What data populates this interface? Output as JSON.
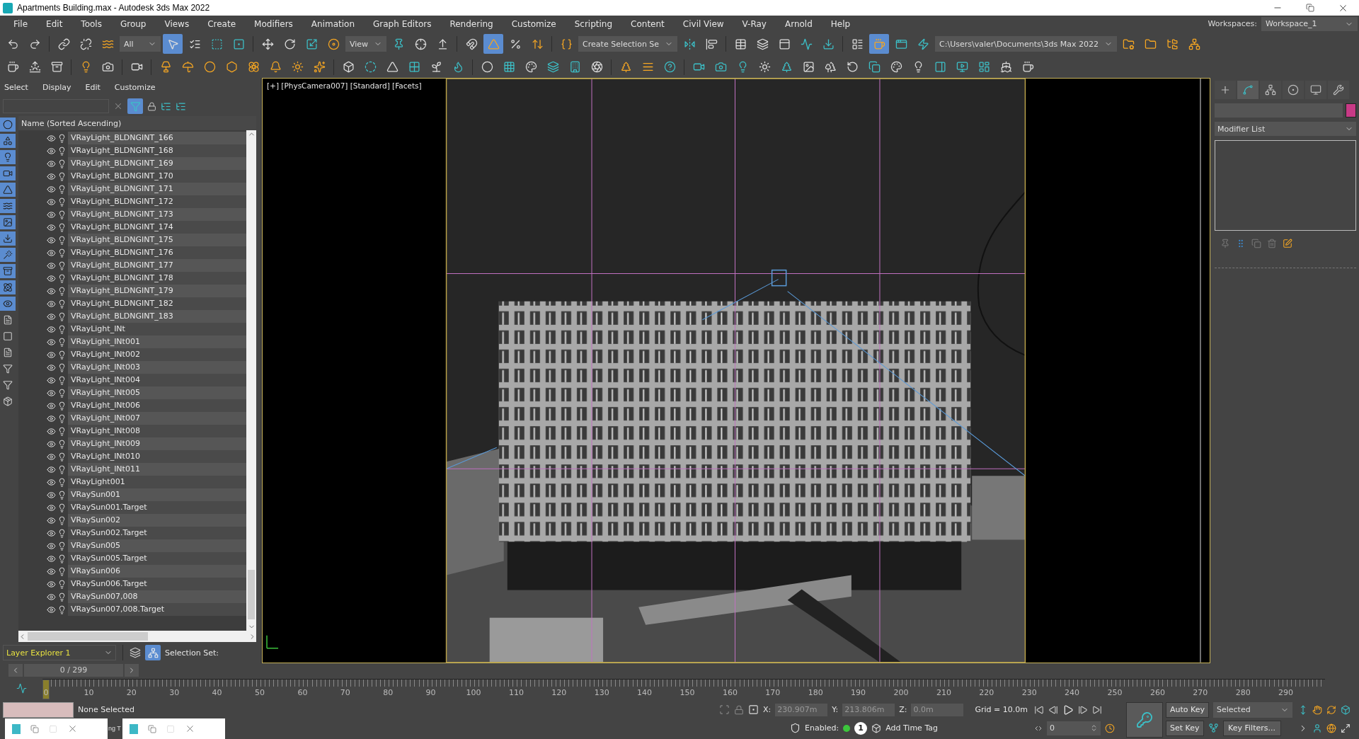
{
  "window": {
    "title": "Apartments Building.max - Autodesk 3ds Max 2022"
  },
  "menu": [
    "File",
    "Edit",
    "Tools",
    "Group",
    "Views",
    "Create",
    "Modifiers",
    "Animation",
    "Graph Editors",
    "Rendering",
    "Customize",
    "Scripting",
    "Content",
    "Civil View",
    "V-Ray",
    "Arnold",
    "Help"
  ],
  "workspaces": {
    "label": "Workspaces:",
    "value": "Workspace_1"
  },
  "toolbar_main": [
    {
      "kind": "tool",
      "selected": false
    },
    {
      "kind": "tool",
      "selected": false
    },
    {
      "kind": "separator"
    },
    {
      "kind": "tool",
      "selected": false
    },
    {
      "kind": "tool",
      "selected": false
    },
    {
      "kind": "tool",
      "selected": false
    },
    {
      "kind": "dropdown",
      "value": "All"
    },
    {
      "kind": "tool",
      "selected": true
    },
    {
      "kind": "tool",
      "selected": false
    },
    {
      "kind": "tool",
      "selected": false
    },
    {
      "kind": "tool",
      "selected": false
    },
    {
      "kind": "separator"
    },
    {
      "kind": "tool",
      "selected": false
    },
    {
      "kind": "tool",
      "selected": false
    },
    {
      "kind": "tool",
      "selected": false
    },
    {
      "kind": "tool",
      "selected": false
    },
    {
      "kind": "dropdown",
      "value": "View"
    },
    {
      "kind": "tool",
      "selected": false
    },
    {
      "kind": "tool",
      "selected": false
    },
    {
      "kind": "tool",
      "selected": false
    },
    {
      "kind": "separator"
    },
    {
      "kind": "tool",
      "selected": false
    },
    {
      "kind": "tool",
      "selected": true
    },
    {
      "kind": "tool",
      "selected": false
    },
    {
      "kind": "tool",
      "selected": false
    },
    {
      "kind": "separator"
    },
    {
      "kind": "tool",
      "selected": false
    },
    {
      "kind": "dropdown",
      "value": "Create Selection Se"
    },
    {
      "kind": "tool",
      "selected": false
    },
    {
      "kind": "tool",
      "selected": false
    },
    {
      "kind": "separator"
    },
    {
      "kind": "tool",
      "selected": false
    },
    {
      "kind": "tool",
      "selected": false
    },
    {
      "kind": "tool",
      "selected": false
    },
    {
      "kind": "tool",
      "selected": false
    },
    {
      "kind": "tool",
      "selected": false
    },
    {
      "kind": "separator"
    },
    {
      "kind": "tool",
      "selected": false
    },
    {
      "kind": "tool",
      "selected": true
    },
    {
      "kind": "tool",
      "selected": false
    },
    {
      "kind": "tool",
      "selected": false
    },
    {
      "kind": "dropdown",
      "value": "C:\\Users\\valer\\Documents\\3ds Max 2022"
    },
    {
      "kind": "tool",
      "selected": false
    },
    {
      "kind": "tool",
      "selected": false
    },
    {
      "kind": "tool",
      "selected": false
    },
    {
      "kind": "tool",
      "selected": false
    }
  ],
  "toolbar_secondary": [
    {
      "kind": "tool",
      "selected": false
    },
    {
      "kind": "tool",
      "selected": false
    },
    {
      "kind": "tool",
      "selected": false
    },
    {
      "kind": "separator"
    },
    {
      "kind": "tool",
      "selected": false
    },
    {
      "kind": "tool",
      "selected": false
    },
    {
      "kind": "separator"
    },
    {
      "kind": "tool",
      "selected": false
    },
    {
      "kind": "separator"
    },
    {
      "kind": "tool",
      "selected": false
    },
    {
      "kind": "tool",
      "selected": false
    },
    {
      "kind": "tool",
      "selected": false
    },
    {
      "kind": "tool",
      "selected": false
    },
    {
      "kind": "tool",
      "selected": false
    },
    {
      "kind": "tool",
      "selected": false
    },
    {
      "kind": "tool",
      "selected": false
    },
    {
      "kind": "tool",
      "selected": false
    },
    {
      "kind": "separator"
    },
    {
      "kind": "tool",
      "selected": false
    },
    {
      "kind": "tool",
      "selected": false
    },
    {
      "kind": "tool",
      "selected": false
    },
    {
      "kind": "tool",
      "selected": false
    },
    {
      "kind": "tool",
      "selected": false
    },
    {
      "kind": "tool",
      "selected": false
    },
    {
      "kind": "separator"
    },
    {
      "kind": "tool",
      "selected": false
    },
    {
      "kind": "tool",
      "selected": false
    },
    {
      "kind": "tool",
      "selected": false
    },
    {
      "kind": "tool",
      "selected": false
    },
    {
      "kind": "tool",
      "selected": false
    },
    {
      "kind": "tool",
      "selected": false
    },
    {
      "kind": "separator"
    },
    {
      "kind": "tool",
      "selected": false
    },
    {
      "kind": "tool",
      "selected": false
    },
    {
      "kind": "tool",
      "selected": false
    },
    {
      "kind": "separator"
    },
    {
      "kind": "tool",
      "selected": false
    },
    {
      "kind": "tool",
      "selected": false
    },
    {
      "kind": "tool",
      "selected": false
    },
    {
      "kind": "tool",
      "selected": false
    },
    {
      "kind": "tool",
      "selected": false
    },
    {
      "kind": "tool",
      "selected": false
    },
    {
      "kind": "tool",
      "selected": false
    },
    {
      "kind": "tool",
      "selected": false
    },
    {
      "kind": "tool",
      "selected": false
    },
    {
      "kind": "tool",
      "selected": false
    },
    {
      "kind": "tool",
      "selected": false
    },
    {
      "kind": "tool",
      "selected": false
    },
    {
      "kind": "tool",
      "selected": false
    },
    {
      "kind": "tool",
      "selected": false
    },
    {
      "kind": "tool",
      "selected": false
    },
    {
      "kind": "tool",
      "selected": false
    }
  ],
  "scene_explorer": {
    "menu": [
      "Select",
      "Display",
      "Edit",
      "Customize"
    ],
    "header": "Name (Sorted Ascending)",
    "filters": [
      {
        "selected": true
      },
      {
        "selected": true
      },
      {
        "selected": true
      },
      {
        "selected": true
      },
      {
        "selected": true
      },
      {
        "selected": true
      },
      {
        "selected": true
      },
      {
        "selected": true
      },
      {
        "selected": true
      },
      {
        "selected": true
      },
      {
        "selected": true
      },
      {
        "selected": true
      },
      {
        "selected": false
      },
      {
        "selected": false
      },
      {
        "selected": false
      },
      {
        "selected": false
      },
      {
        "selected": false
      },
      {
        "selected": false
      }
    ],
    "items": [
      {
        "name": "VRayLight_BLDNGINT_166"
      },
      {
        "name": "VRayLight_BLDNGINT_168"
      },
      {
        "name": "VRayLight_BLDNGINT_169"
      },
      {
        "name": "VRayLight_BLDNGINT_170"
      },
      {
        "name": "VRayLight_BLDNGINT_171"
      },
      {
        "name": "VRayLight_BLDNGINT_172"
      },
      {
        "name": "VRayLight_BLDNGINT_173"
      },
      {
        "name": "VRayLight_BLDNGINT_174"
      },
      {
        "name": "VRayLight_BLDNGINT_175"
      },
      {
        "name": "VRayLight_BLDNGINT_176"
      },
      {
        "name": "VRayLight_BLDNGINT_177"
      },
      {
        "name": "VRayLight_BLDNGINT_178"
      },
      {
        "name": "VRayLight_BLDNGINT_179"
      },
      {
        "name": "VRayLight_BLDNGINT_182"
      },
      {
        "name": "VRayLight_BLDNGINT_183"
      },
      {
        "name": "VRayLight_INt"
      },
      {
        "name": "VRayLight_INt001"
      },
      {
        "name": "VRayLight_INt002"
      },
      {
        "name": "VRayLight_INt003"
      },
      {
        "name": "VRayLight_INt004"
      },
      {
        "name": "VRayLight_INt005"
      },
      {
        "name": "VRayLight_INt006"
      },
      {
        "name": "VRayLight_INt007"
      },
      {
        "name": "VRayLight_INt008"
      },
      {
        "name": "VRayLight_INt009"
      },
      {
        "name": "VRayLight_INt010"
      },
      {
        "name": "VRayLight_INt011"
      },
      {
        "name": "VRayLight001"
      },
      {
        "name": "VRaySun001"
      },
      {
        "name": "VRaySun001.Target"
      },
      {
        "name": "VRaySun002"
      },
      {
        "name": "VRaySun002.Target"
      },
      {
        "name": "VRaySun005"
      },
      {
        "name": "VRaySun005.Target"
      },
      {
        "name": "VRaySun006"
      },
      {
        "name": "VRaySun006.Target"
      },
      {
        "name": "VRaySun007,008"
      },
      {
        "name": "VRaySun007,008.Target"
      }
    ],
    "layer_explorer": "Layer Explorer 1",
    "selection_set_label": "Selection Set:"
  },
  "viewport": {
    "label": "[+] [PhysCamera007] [Standard] [Facets]"
  },
  "command_panel": {
    "tabs": [
      {
        "selected": false
      },
      {
        "selected": true
      },
      {
        "selected": false
      },
      {
        "selected": false
      },
      {
        "selected": false
      },
      {
        "selected": false
      }
    ],
    "modifier_list": "Modifier List"
  },
  "time_slider": {
    "value": "0 / 299"
  },
  "track_bar": {
    "ticks": [
      "0",
      "10",
      "20",
      "30",
      "40",
      "50",
      "60",
      "70",
      "80",
      "90",
      "100",
      "110",
      "120",
      "130",
      "140",
      "150",
      "160",
      "170",
      "180",
      "190",
      "200",
      "210",
      "220",
      "230",
      "240",
      "250",
      "260",
      "270",
      "280",
      "290"
    ]
  },
  "status": {
    "selection": "None Selected",
    "hidden_text": "ng T",
    "x_label": "X:",
    "x": "230.907m",
    "y_label": "Y:",
    "y": "213.806m",
    "z_label": "Z:",
    "z": "0.0m",
    "grid": "Grid = 10.0m",
    "enabled_label": "Enabled:",
    "enabled": true,
    "time_tag_count": "1",
    "add_time_tag": "Add Time Tag"
  },
  "animation": {
    "auto_key": "Auto Key",
    "set_key": "Set Key",
    "key_mode": "Selected",
    "key_filters": "Key Filters...",
    "frame": "0"
  }
}
